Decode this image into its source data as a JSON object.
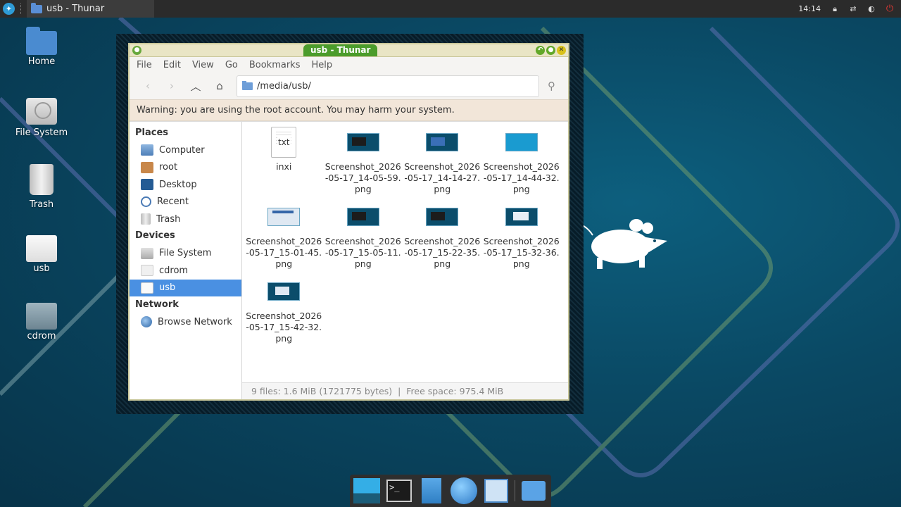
{
  "panel": {
    "task_title": "usb - Thunar",
    "clock": "14:14"
  },
  "desktop_icons": [
    {
      "label": "Home"
    },
    {
      "label": "File System"
    },
    {
      "label": "Trash"
    },
    {
      "label": "usb"
    },
    {
      "label": "cdrom"
    }
  ],
  "window": {
    "title": "usb - Thunar",
    "menu": [
      "File",
      "Edit",
      "View",
      "Go",
      "Bookmarks",
      "Help"
    ],
    "location": "/media/usb/",
    "warning": "Warning: you are using the root account. You may harm your system.",
    "sidebar": {
      "places_heading": "Places",
      "places": [
        "Computer",
        "root",
        "Desktop",
        "Recent",
        "Trash"
      ],
      "devices_heading": "Devices",
      "devices": [
        "File System",
        "cdrom",
        "usb"
      ],
      "network_heading": "Network",
      "network": [
        "Browse Network"
      ]
    },
    "files": [
      {
        "name_lines": [
          "inxi"
        ],
        "icon": "txt",
        "icon_text": "txt"
      },
      {
        "name_lines": [
          "Screenshot_2026",
          "-05-17_14-05-59.",
          "png"
        ]
      },
      {
        "name_lines": [
          "Screenshot_2026",
          "-05-17_14-14-27.",
          "png"
        ]
      },
      {
        "name_lines": [
          "Screenshot_2026",
          "-05-17_14-44-32.",
          "png"
        ]
      },
      {
        "name_lines": [
          "Screenshot_2026",
          "-05-17_15-01-45.",
          "png"
        ]
      },
      {
        "name_lines": [
          "Screenshot_2026",
          "-05-17_15-05-11.",
          "png"
        ]
      },
      {
        "name_lines": [
          "Screenshot_2026",
          "-05-17_15-22-35.",
          "png"
        ]
      },
      {
        "name_lines": [
          "Screenshot_2026",
          "-05-17_15-32-36.",
          "png"
        ]
      },
      {
        "name_lines": [
          "Screenshot_2026",
          "-05-17_15-42-32.",
          "png"
        ]
      }
    ],
    "status": "9 files: 1.6 MiB (1721775 bytes)  |  Free space: 975.4 MiB"
  },
  "dock": {
    "items": [
      "show-desktop",
      "terminal",
      "file-manager",
      "web-browser",
      "app-finder",
      "folder"
    ]
  },
  "colors": {
    "selection": "#4a90e2",
    "title_tab": "#4b9c2b",
    "warning_bg": "#f2e6d9"
  }
}
